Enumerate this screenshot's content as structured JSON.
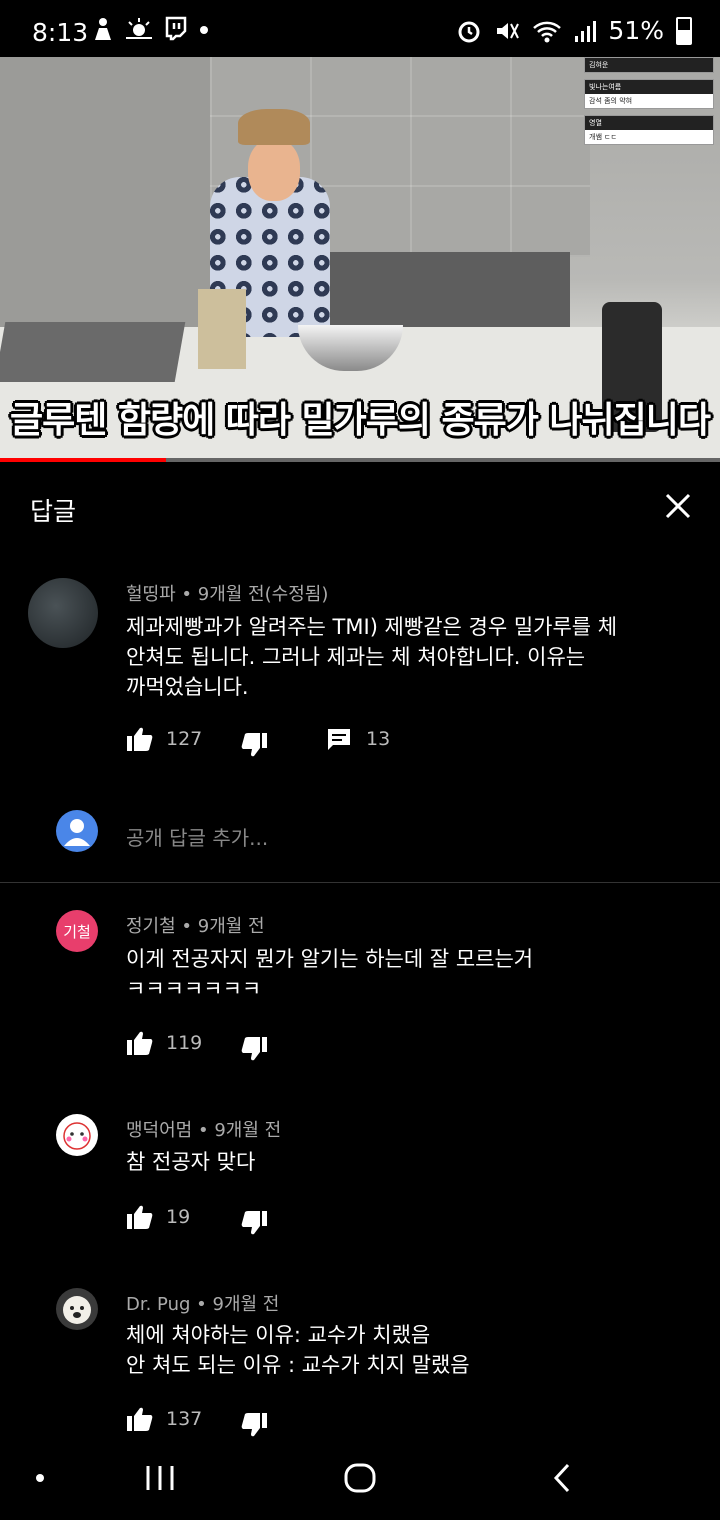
{
  "status_bar": {
    "time": "8:13",
    "battery_percent": "51%",
    "battery_level": 0.51
  },
  "video": {
    "subtitle": "글루텐 함량에 따라 밀가루의 종류가 나뉘집니다",
    "progress": 0.23,
    "overlay": [
      {
        "name": "김혀운",
        "message": ""
      },
      {
        "name": "빛나는여름",
        "message": "감석 좀의 약혀"
      },
      {
        "name": "영열",
        "message": "개쌤 ㄷㄷ"
      }
    ]
  },
  "panel": {
    "title": "답글",
    "reply_placeholder": "공개 답글 추가..."
  },
  "parent_comment": {
    "author": "헐띵파",
    "time": "9개월 전(수정됨)",
    "text": "제과제빵과가 알려주는 TMI) 제빵같은 경우 밀가루를 체\n안쳐도 됩니다. 그러나 제과는 체 쳐야합니다. 이유는\n까먹었습니다.",
    "likes": "127",
    "replies": "13"
  },
  "replies": [
    {
      "author": "정기철",
      "time": "9개월 전",
      "avatar_text": "기철",
      "avatar_color": "#e83e6c",
      "text": "이게 전공자지 뭔가 알기는 하는데 잘 모르는거\nㅋㅋㅋㅋㅋㅋㅋ",
      "likes": "119"
    },
    {
      "author": "맹덕어멈",
      "time": "9개월 전",
      "avatar_text": "",
      "avatar_color": "#ffffff",
      "text": "참 전공자 맞다",
      "likes": "19"
    },
    {
      "author": "Dr. Pug",
      "time": "9개월 전",
      "avatar_text": "",
      "avatar_color": "#3a3a3a",
      "text": "체에 쳐야하는 이유: 교수가 치랬음\n안 쳐도 되는 이유 : 교수가 치지 말랬음",
      "likes": "137"
    }
  ],
  "colors": {
    "accent_red": "#ff0000",
    "meta_gray": "#aaaaaa",
    "user_avatar_blue": "#4a86e8"
  }
}
